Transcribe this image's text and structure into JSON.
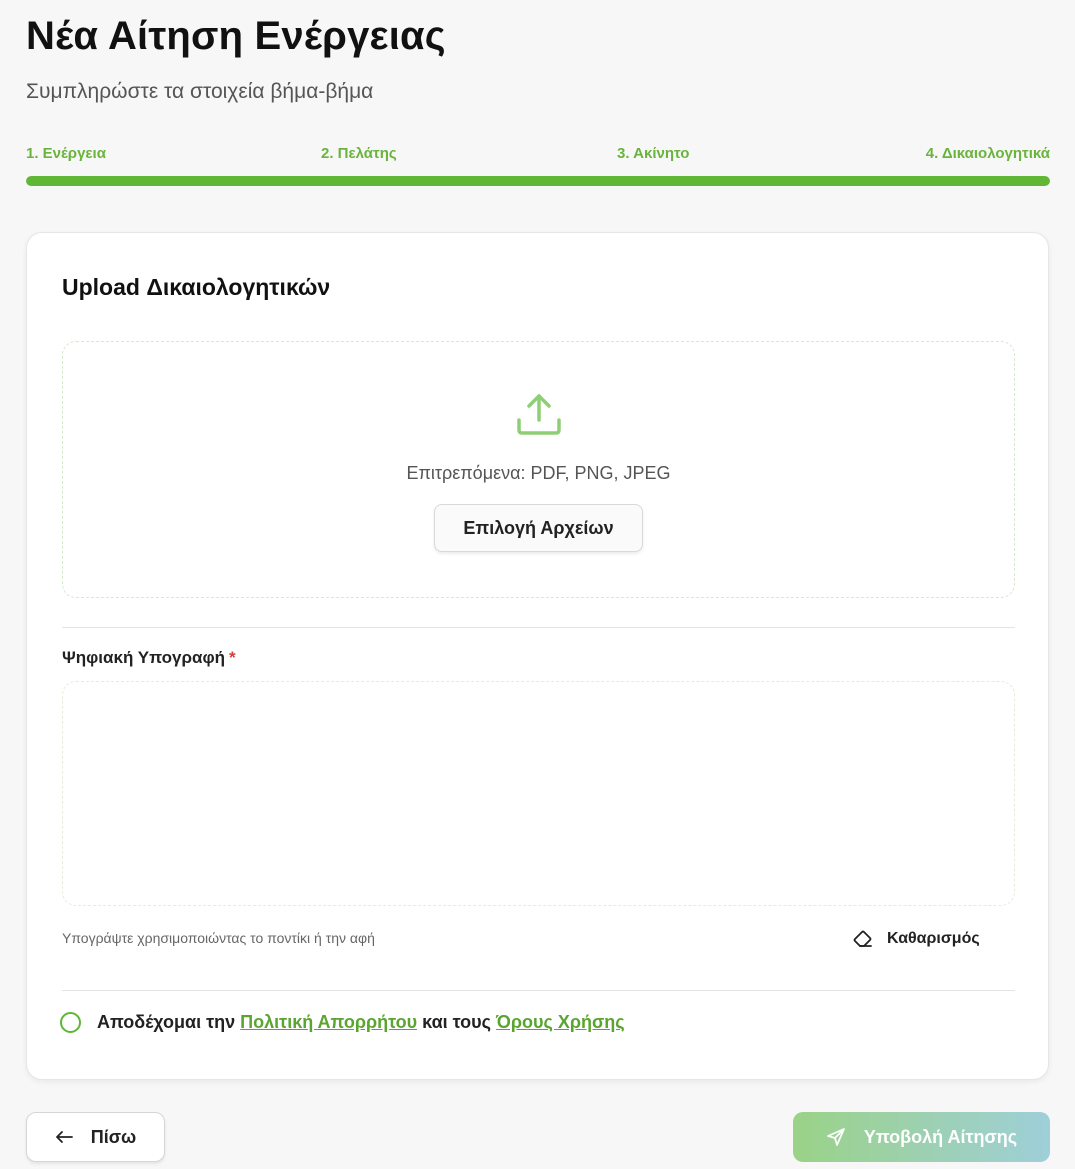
{
  "header": {
    "title": "Νέα Αίτηση Ενέργειας",
    "subtitle": "Συμπληρώστε τα στοιχεία βήμα-βήμα"
  },
  "steps": [
    {
      "label": "1. Ενέργεια"
    },
    {
      "label": "2. Πελάτης"
    },
    {
      "label": "3. Ακίνητο"
    },
    {
      "label": "4. Δικαιολογητικά"
    }
  ],
  "progress": {
    "current_step": 4,
    "total_steps": 4,
    "fraction": 1.0
  },
  "upload": {
    "title": "Upload Δικαιολογητικών",
    "icon": "upload-icon",
    "allowed_text": "Επιτρεπόμενα: PDF, PNG, JPEG",
    "choose_button": "Επιλογή Αρχείων"
  },
  "signature": {
    "label": "Ψηφιακή Υπογραφή",
    "required_marker": "*",
    "hint": "Υπογράψτε χρησιμοποιώντας το ποντίκι ή την αφή",
    "clear_button": "Καθαρισμός",
    "clear_icon": "eraser-icon"
  },
  "consent": {
    "prefix": "Αποδέχομαι την",
    "privacy_link": "Πολιτική Απορρήτου",
    "middle": "και τους",
    "terms_link": "Όρους Χρήσης",
    "checked": false
  },
  "footer": {
    "back_label": "Πίσω",
    "back_icon": "arrow-left-icon",
    "submit_label": "Υποβολή Αίτησης",
    "submit_icon": "send-icon"
  },
  "colors": {
    "accent": "#62b636",
    "link": "#5aa52f",
    "required": "#d93b3b"
  }
}
